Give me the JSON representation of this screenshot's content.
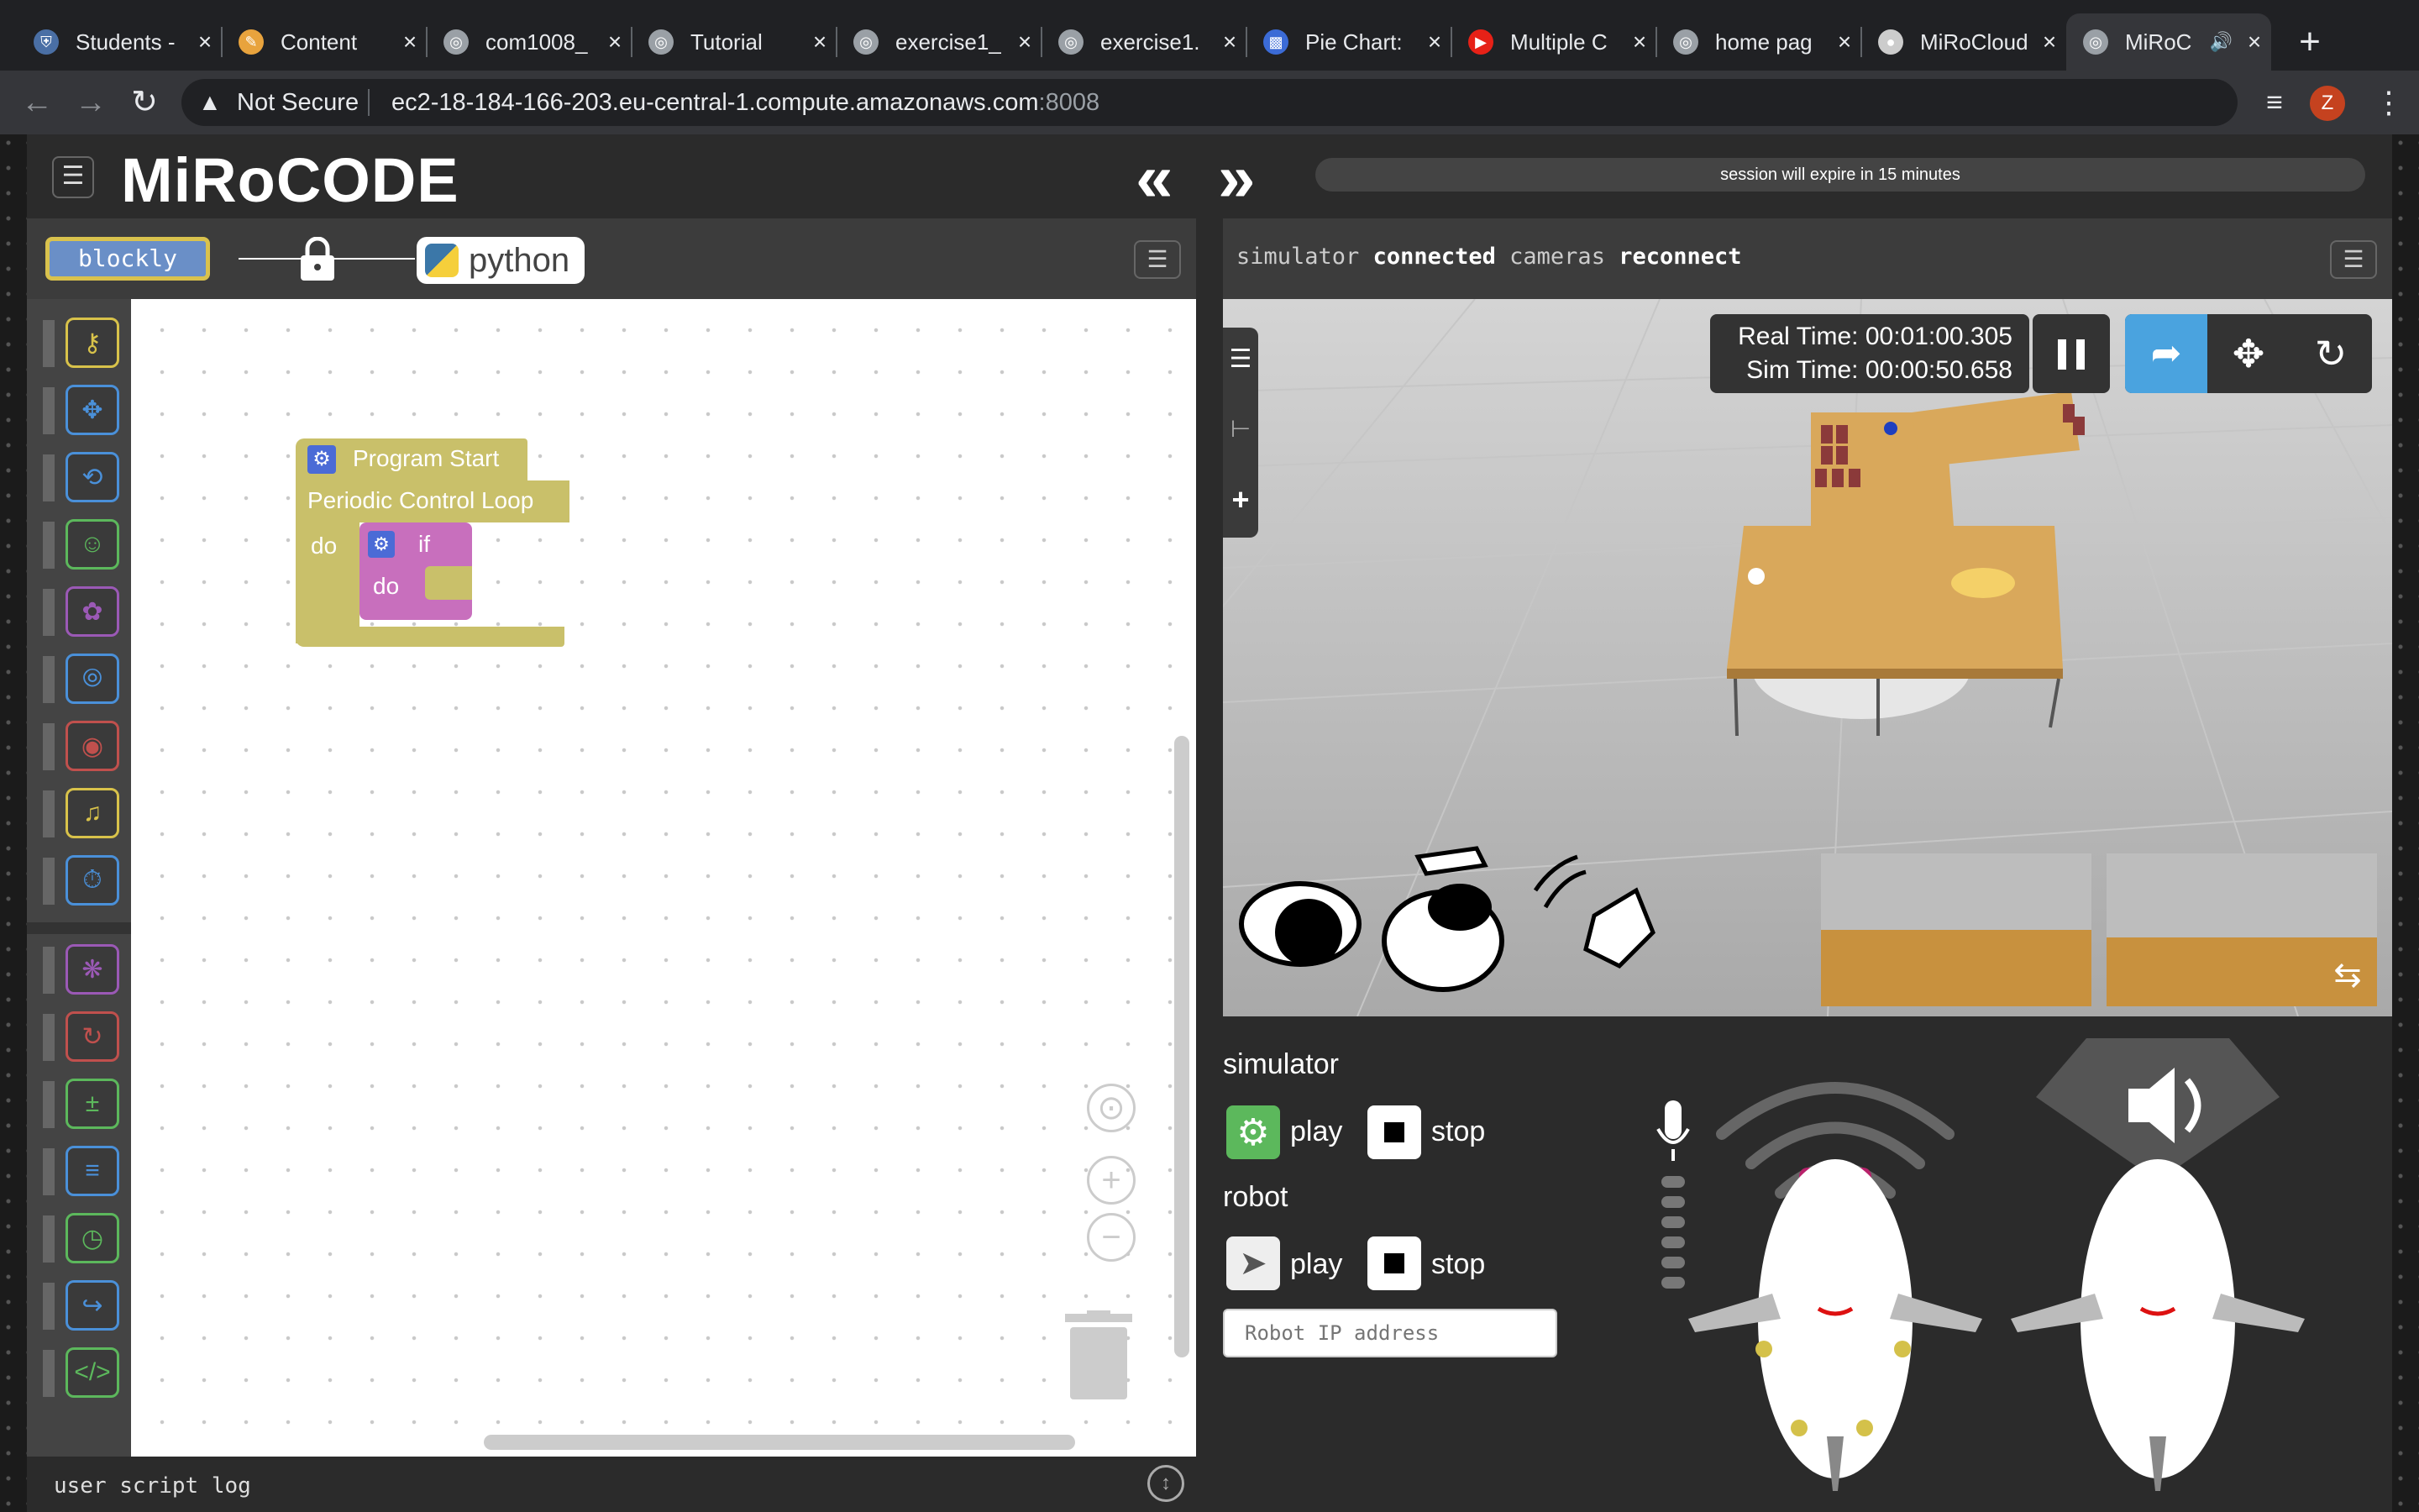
{
  "browser": {
    "tabs": [
      {
        "title": "Students -",
        "icon": "shield-icon",
        "color": "#4a6fa5"
      },
      {
        "title": "Content",
        "icon": "pencil-icon",
        "color": "#e8a33d"
      },
      {
        "title": "com1008_",
        "icon": "globe-icon",
        "color": "#9aa0a6"
      },
      {
        "title": "Tutorial",
        "icon": "globe-icon",
        "color": "#9aa0a6"
      },
      {
        "title": "exercise1_",
        "icon": "globe-icon",
        "color": "#9aa0a6"
      },
      {
        "title": "exercise1.",
        "icon": "globe-icon",
        "color": "#9aa0a6"
      },
      {
        "title": "Pie Chart:",
        "icon": "bar-chart-icon",
        "color": "#3b6bd6"
      },
      {
        "title": "Multiple C",
        "icon": "youtube-icon",
        "color": "#e62117"
      },
      {
        "title": "home pag",
        "icon": "globe-icon",
        "color": "#9aa0a6"
      },
      {
        "title": "MiRoCloud",
        "icon": "miro-icon",
        "color": "#cccccc"
      },
      {
        "title": "MiRoC",
        "icon": "globe-icon",
        "color": "#9aa0a6"
      }
    ],
    "security_label": "Not Secure",
    "url_host": "ec2-18-184-166-203.eu-central-1.compute.amazonaws.com",
    "url_port": ":8008",
    "profile_initial": "Z"
  },
  "app": {
    "logo": "MiRoCODE",
    "session_text": "session will expire in 15 minutes"
  },
  "editor": {
    "blockly_label": "blockly",
    "python_label": "python",
    "blocks": {
      "program_start": "Program Start",
      "loop": "Periodic Control Loop",
      "do": "do",
      "if": "if",
      "if_do": "do"
    },
    "log_label": "user script log"
  },
  "simulator": {
    "status": {
      "w1": "simulator",
      "w2": "connected",
      "w3": "cameras",
      "w4": "reconnect"
    },
    "real_time": "Real Time: 00:01:00.305",
    "sim_time": "Sim Time: 00:00:50.658"
  },
  "controls": {
    "simulator_heading": "simulator",
    "robot_heading": "robot",
    "play": "play",
    "stop": "stop",
    "ip_placeholder": "Robot IP address"
  },
  "colors": {
    "accent_blue": "#4aa3df",
    "block_olive": "#c9c06a",
    "block_pink": "#c86fbd",
    "toolbox_gold": "#d8c24a",
    "toolbox_blue": "#4a90d9",
    "toolbox_purple": "#9b59b6",
    "toolbox_green": "#5cb85c",
    "toolbox_red": "#c0504d"
  }
}
